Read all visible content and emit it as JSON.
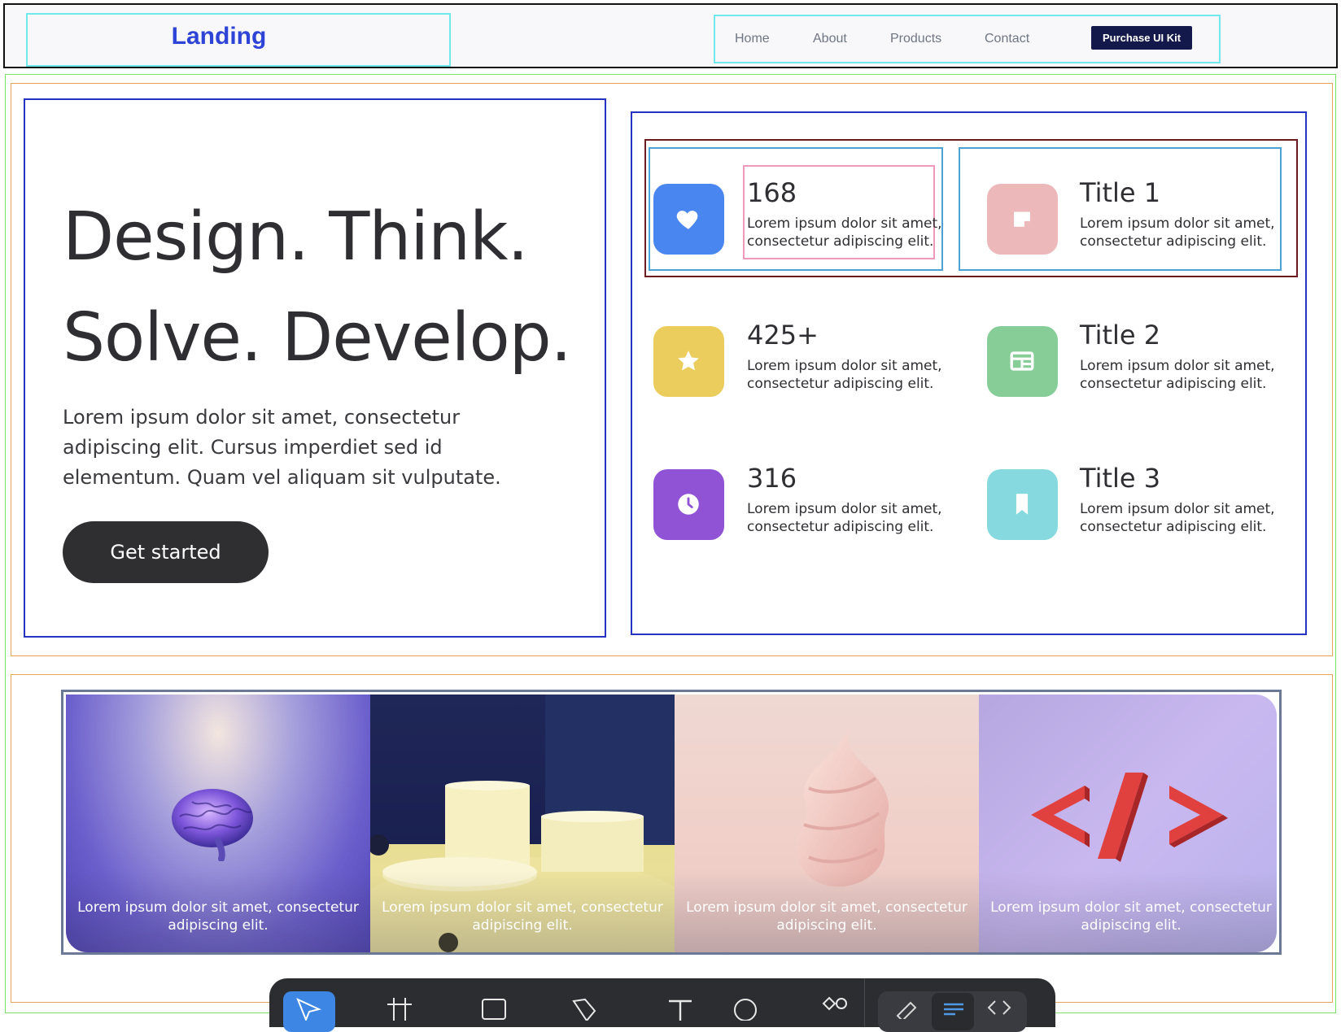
{
  "header": {
    "logo": "Landing",
    "nav": [
      "Home",
      "About",
      "Products",
      "Contact"
    ],
    "cta": "Purchase UI Kit"
  },
  "hero": {
    "title_line1": "Design. Think.",
    "title_line2": "Solve. Develop.",
    "text": "Lorem ipsum dolor sit amet, consectetur adipiscing elit. Cursus imperdiet sed id elementum. Quam vel aliquam sit vulputate.",
    "button": "Get started"
  },
  "features": [
    {
      "title": "168",
      "desc": "Lorem ipsum dolor sit amet, consectetur adipiscing elit.",
      "icon": "heart-icon",
      "color": "#4a86f0"
    },
    {
      "title": "Title 1",
      "desc": "Lorem ipsum dolor sit amet, consectetur adipiscing elit.",
      "icon": "note-icon",
      "color": "#ecb8b9"
    },
    {
      "title": "425+",
      "desc": "Lorem ipsum dolor sit amet, consectetur adipiscing elit.",
      "icon": "star-icon",
      "color": "#ebcd5d"
    },
    {
      "title": "Title 2",
      "desc": "Lorem ipsum dolor sit amet, consectetur adipiscing elit.",
      "icon": "layout-icon",
      "color": "#86cd97"
    },
    {
      "title": "316",
      "desc": "Lorem ipsum dolor sit amet, consectetur adipiscing elit.",
      "icon": "clock-icon",
      "color": "#9053d6"
    },
    {
      "title": "Title 3",
      "desc": "Lorem ipsum dolor sit amet, consectetur adipiscing elit.",
      "icon": "bookmark-icon",
      "color": "#86dadf"
    }
  ],
  "gallery": [
    {
      "caption": "Lorem ipsum dolor sit amet, consectetur adipiscing elit.",
      "image": "brain"
    },
    {
      "caption": "Lorem ipsum dolor sit amet, consectetur adipiscing elit.",
      "image": "podiums"
    },
    {
      "caption": "Lorem ipsum dolor sit amet, consectetur adipiscing elit.",
      "image": "cream-swirl"
    },
    {
      "caption": "Lorem ipsum dolor sit amet, consectetur adipiscing elit.",
      "image": "code-symbol"
    }
  ],
  "toolbar": {
    "icons": [
      "pointer-icon",
      "frame-icon",
      "rectangle-icon",
      "pen-icon",
      "text-icon",
      "ellipse-icon",
      "components-icon",
      "draw-icon",
      "layout-tool-icon",
      "code-icon"
    ]
  }
}
